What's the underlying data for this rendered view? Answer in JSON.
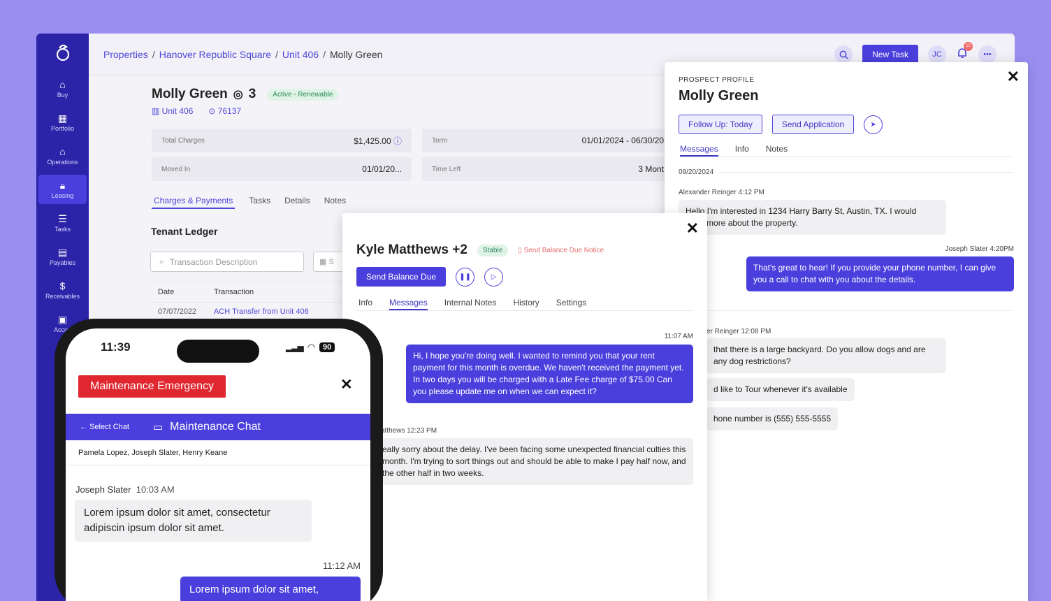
{
  "breadcrumb": [
    "Properties",
    "Hanover Republic Square",
    "Unit 406",
    "Molly Green"
  ],
  "topbar": {
    "new_task": "New Task",
    "avatar": "JC",
    "notif_count": "10"
  },
  "sidebar": [
    {
      "label": "Buy",
      "icon": "house-icon"
    },
    {
      "label": "Portfolio",
      "icon": "building-icon"
    },
    {
      "label": "Operations",
      "icon": "house-gear-icon"
    },
    {
      "label": "Leasing",
      "icon": "lock-icon",
      "active": true
    },
    {
      "label": "Tasks",
      "icon": "list-icon"
    },
    {
      "label": "Payables",
      "icon": "document-icon"
    },
    {
      "label": "Receivables",
      "icon": "dollar-document-icon"
    },
    {
      "label": "Accou",
      "icon": "calculator-icon"
    }
  ],
  "tenant": {
    "name": "Molly Green",
    "occupants": "3",
    "status": "Active - Renewable",
    "unit": "Unit 406",
    "zip": "76137"
  },
  "stats": {
    "total_charges_label": "Total Charges",
    "total_charges": "$1,425.00",
    "term_label": "Term",
    "term": "01/01/2024 - 06/30/20",
    "moved_in_label": "Moved In",
    "moved_in": "01/01/20...",
    "time_left_label": "Time Left",
    "time_left": "3 Mont"
  },
  "ledger_tabs": [
    "Charges & Payments",
    "Tasks",
    "Details",
    "Notes"
  ],
  "ledger": {
    "title": "Tenant Ledger",
    "search_placeholder": "Transaction Description",
    "date_stub": "S",
    "col_date": "Date",
    "col_transaction": "Transaction",
    "row_date": "07/07/2022",
    "row_transaction": "ACH Transfer from Unit 406"
  },
  "prospect": {
    "label": "PROSPECT PROFILE",
    "name": "Molly Green",
    "follow_up": "Follow Up: Today",
    "send_application": "Send Application",
    "tabs": [
      "Messages",
      "Info",
      "Notes"
    ],
    "date": "09/20/2024",
    "m1_meta": "Alexander Reinger  4:12 PM",
    "m1_text_a": "Hello I'm interested in",
    "m1_addr": "1234 Harry Barry St, Austin, TX.",
    "m1_text_b": "I would",
    "m1_text_c": "learn more about the property.",
    "m2_meta": "Joseph Slater  4:20PM",
    "m2_text": "That's great to hear! If you provide your phone number, I can give you a call to chat with you about the details.",
    "m3_meta": "er Reinger  12:08 PM",
    "m3_text": "that there is a large backyard. Do you allow dogs and are any dog restrictions?",
    "m4_text": "d like to Tour whenever it's available",
    "m5_text_a": "hone number is",
    "m5_phone": "(555) 555-5555"
  },
  "kyle": {
    "name": "Kyle Matthews +2",
    "status": "Stable",
    "notice": "Send Balance Due Notice",
    "send_due": "Send Balance Due",
    "tabs": [
      "Info",
      "Messages",
      "Internal Notes",
      "History",
      "Settings"
    ],
    "m1_time": "11:07 AM",
    "m1_text": "Hi, I hope you're doing well. I wanted to remind you that your rent payment for this month is overdue. We haven't received the payment yet. In two days you will be charged with a Late Fee charge of $75.00 Can you please update me on when we can expect it?",
    "m2_meta": "atthews  12:23 PM",
    "m2_text": "eally sorry about the delay. I've been facing some unexpected financial culties this month. I'm trying to sort things out and should be able to make I pay half now, and the other half in two weeks."
  },
  "phone": {
    "time": "11:39",
    "battery": "90",
    "emergency": "Maintenance Emergency",
    "back": "Select Chat",
    "chat_title": "Maintenance Chat",
    "participants": "Pamela Lopez, Joseph Slater, Henry Keane",
    "m1_sender": "Joseph Slater",
    "m1_time": "10:03 AM",
    "m1_text": "Lorem ipsum dolor sit amet, consectetur adipiscin ipsum dolor sit amet.",
    "m2_time": "11:12 AM",
    "m2_text": "Lorem ipsum dolor sit amet,"
  },
  "colors": {
    "background": "#9a8ff0",
    "sidebar": "#2b23a8",
    "accent": "#4a3fdc",
    "emergency": "#e0262e"
  }
}
